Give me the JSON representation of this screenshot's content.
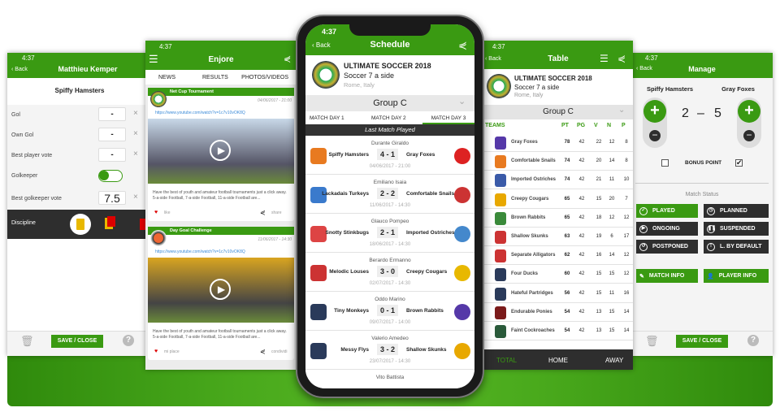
{
  "colors": {
    "brand_green": "#3a9a12",
    "dark": "#2e2e2e"
  },
  "status_time": "4:37",
  "player_screen": {
    "back": "Back",
    "title": "Matthieu Kemper",
    "team": "Spiffy Hamsters",
    "fields": [
      {
        "label": "Gol",
        "value": "-"
      },
      {
        "label": "Own Gol",
        "value": "-"
      },
      {
        "label": "Best player vote",
        "value": "-"
      },
      {
        "label": "Golkeeper",
        "toggle": true
      },
      {
        "label": "Best golkeeper vote",
        "value": "7.5"
      }
    ],
    "discipline": "Discipline",
    "save": "SAVE / CLOSE",
    "help": "?"
  },
  "news_screen": {
    "title": "Enjore",
    "tabs": [
      "NEWS",
      "RESULTS",
      "PHOTOS/VIDEOS"
    ],
    "posts": [
      {
        "title": "Net Cup Tournament",
        "date": "04/06/2017 - 21:00",
        "link": "https://www.youtube.com/watch?v=1c7v10vOK8Q",
        "text": "Have the best of youth and amateur football tournaments just a click away. 5-a-side Football, 7-a-side Football, 11-a-side Football are...",
        "like": "like",
        "share": "share"
      },
      {
        "title": "Day Goal Challenge",
        "date": "11/06/2017 - 14:30",
        "link": "https://www.youtube.com/watch?v=1c7v10vOK8Q",
        "text": "Have the best of youth and amateur football tournaments just a click away. 5-a-side Football, 7-a-side Football, 11-a-side Football are...",
        "like": "mi place",
        "share": "condividi"
      }
    ]
  },
  "schedule_screen": {
    "back": "Back",
    "title": "Schedule",
    "tournament": "ULTIMATE SOCCER 2018",
    "format": "Soccer 7 a side",
    "location": "Rome, Italy",
    "group": "Group C",
    "tabs": [
      "MATCH DAY 1",
      "MATCH DAY 2",
      "MATCH DAY 3"
    ],
    "active_tab": 2,
    "section": "Last Match Played",
    "matches": [
      {
        "referee": "Durante Giraldo",
        "home": "Spiffy Hamsters",
        "score": "4 - 1",
        "away": "Gray Foxes",
        "date": "04/06/2017 - 21:00"
      },
      {
        "referee": "Emiliano Isaia",
        "home": "Lackadais Turkeys",
        "score": "2 - 2",
        "away": "Comfortable Snails",
        "date": "11/06/2017 - 14:30"
      },
      {
        "referee": "Glauco Pompeo",
        "home": "Snotty Stinkbugs",
        "score": "2 - 1",
        "away": "Imported Ostriches",
        "date": "18/06/2017 - 14:30"
      },
      {
        "referee": "Berardo Ermanno",
        "home": "Melodic Louses",
        "score": "3 - 0",
        "away": "Creepy Cougars",
        "date": "02/07/2017 - 14:30"
      },
      {
        "referee": "Oddo Marino",
        "home": "Tiny Monkeys",
        "score": "0 - 1",
        "away": "Brown Rabbits",
        "date": "09/07/2017 - 14:00"
      },
      {
        "referee": "Valerio Amedeo",
        "home": "Messy Flys",
        "score": "3 - 2",
        "away": "Shallow Skunks",
        "date": "23/07/2017 - 14:30"
      },
      {
        "referee": "Vito Battista",
        "home": "",
        "score": "",
        "away": "",
        "date": ""
      }
    ]
  },
  "table_screen": {
    "back": "Back",
    "title": "Table",
    "tournament": "ULTIMATE SOCCER 2018",
    "format": "Soccer 7 a side",
    "location": "Rome, Italy",
    "group": "Group C",
    "columns": [
      "TEAMS",
      "PT",
      "PG",
      "V",
      "N",
      "P"
    ],
    "rows": [
      [
        "Gray Foxes",
        78,
        42,
        22,
        12,
        8
      ],
      [
        "Comfortable Snails",
        74,
        42,
        20,
        14,
        8
      ],
      [
        "Imported Ostriches",
        74,
        42,
        21,
        11,
        10
      ],
      [
        "Creepy Cougars",
        65,
        42,
        15,
        20,
        7
      ],
      [
        "Brown Rabbits",
        65,
        42,
        18,
        12,
        12
      ],
      [
        "Shallow Skunks",
        63,
        42,
        19,
        6,
        17
      ],
      [
        "Separate Alligators",
        62,
        42,
        16,
        14,
        12
      ],
      [
        "Four Ducks",
        60,
        42,
        15,
        15,
        12
      ],
      [
        "Hateful Partridges",
        56,
        42,
        15,
        11,
        16
      ],
      [
        "Endurable Ponies",
        54,
        42,
        13,
        15,
        14
      ],
      [
        "Faint Cockroaches",
        54,
        42,
        13,
        15,
        14
      ]
    ],
    "bottom_tabs": [
      "TOTAL",
      "HOME",
      "AWAY"
    ],
    "active_bottom": 0
  },
  "manage_screen": {
    "back": "Back",
    "title": "Manage",
    "home": "Spiffy Hamsters",
    "away": "Gray Foxes",
    "home_score": "2",
    "sep": "–",
    "away_score": "5",
    "bonus": "BONUS POINT",
    "bonus_home": false,
    "bonus_away": true,
    "status_label": "Match Status",
    "statuses": [
      {
        "label": "PLAYED",
        "icon": "check-icon",
        "active": true
      },
      {
        "label": "PLANNED",
        "icon": "clock-icon"
      },
      {
        "label": "ONGOING",
        "icon": "play-icon"
      },
      {
        "label": "SUSPENDED",
        "icon": "pause-icon"
      },
      {
        "label": "POSTPONED",
        "icon": "postpone-icon"
      },
      {
        "label": "L. BY DEFAULT",
        "icon": "alert-icon"
      }
    ],
    "match_info": "MATCH INFO",
    "player_info": "PLAYER INFO",
    "save": "SAVE / CLOSE",
    "help": "?"
  }
}
